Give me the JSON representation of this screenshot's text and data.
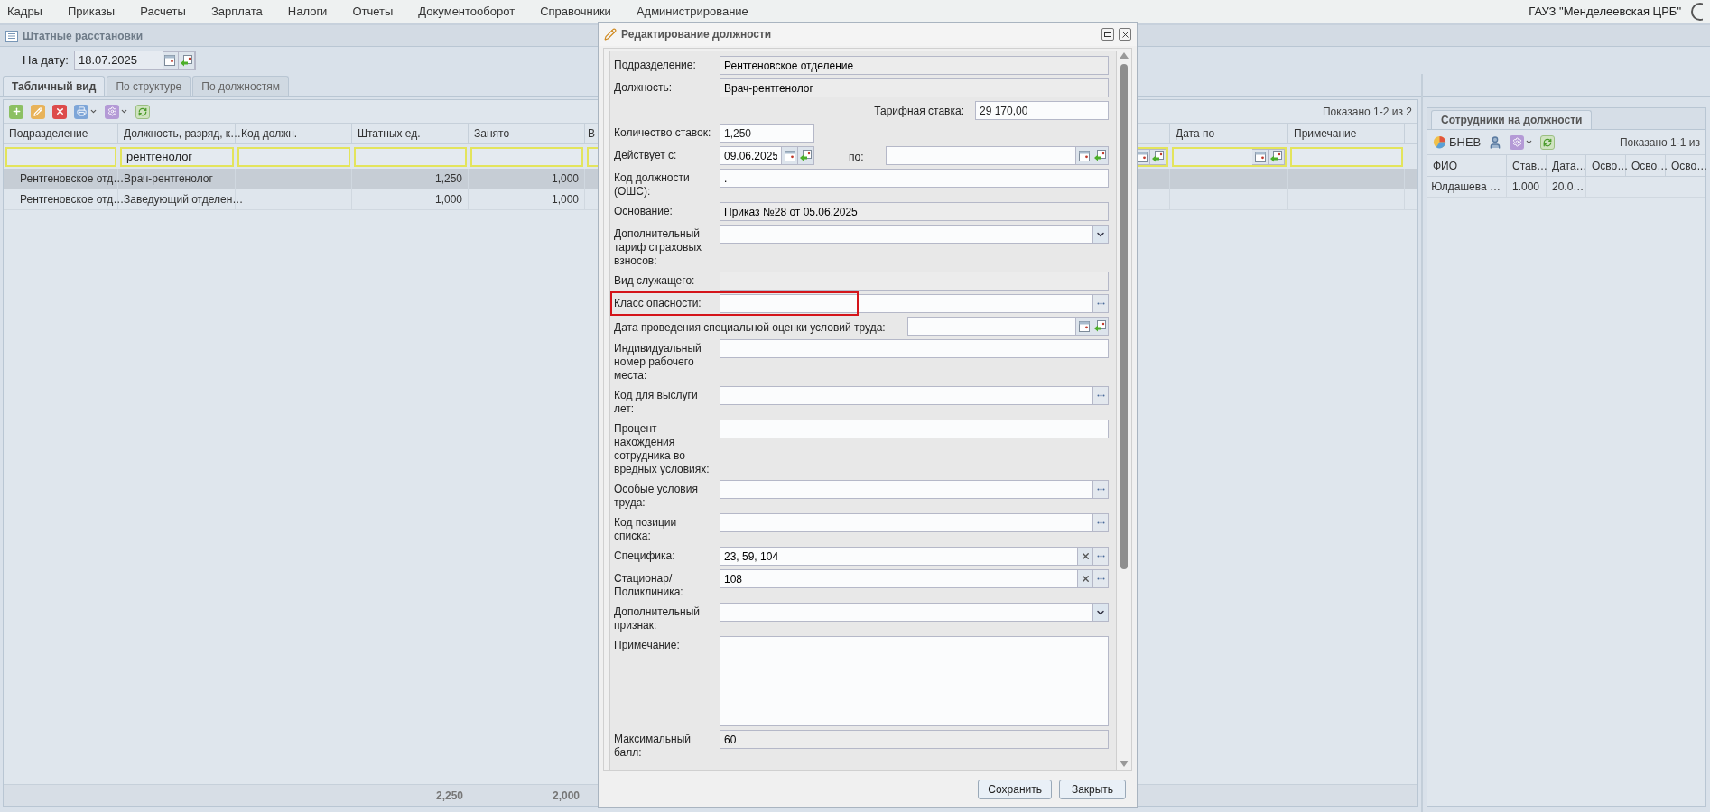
{
  "menu": [
    "Кадры",
    "Приказы",
    "Расчеты",
    "Зарплата",
    "Налоги",
    "Отчеты",
    "Документооборот",
    "Справочники",
    "Администрирование"
  ],
  "organization": "ГАУЗ \"Менделеевская ЦРБ\"",
  "panel": {
    "title": "Штатные расстановки",
    "date_label": "На дату:",
    "date_value": "18.07.2025"
  },
  "tabs": [
    {
      "label": "Табличный вид",
      "selected": true
    },
    {
      "label": "По структуре",
      "selected": false
    },
    {
      "label": "По должностям",
      "selected": false
    }
  ],
  "grid": {
    "paging": "Показано 1-2 из 2",
    "columns": [
      {
        "header": "Подразделение",
        "kind": "text"
      },
      {
        "header": "Должность, разряд, к…",
        "kind": "text",
        "filter_value": "рентгенолог"
      },
      {
        "header": "Код должн.",
        "kind": "text"
      },
      {
        "header": "Штатных ед.",
        "kind": "text"
      },
      {
        "header": "Занято",
        "kind": "text"
      },
      {
        "header": "В",
        "kind": "text"
      },
      {
        "kind": "date"
      },
      {
        "header": "Дата по",
        "kind": "date"
      },
      {
        "header": "Примечание",
        "kind": "text"
      }
    ],
    "rows": [
      {
        "selected": true,
        "subdivision": "Рентгеновское отд…",
        "position": "Врач-рентгенолог",
        "staff_units": "1,250",
        "occupied": "1,000"
      },
      {
        "selected": false,
        "subdivision": "Рентгеновское отд…",
        "position": "Заведующий отделен…",
        "staff_units": "1,000",
        "occupied": "1,000"
      }
    ],
    "totals": {
      "staff_units": "2,250",
      "occupied": "2,000"
    }
  },
  "employees": {
    "tab": "Сотрудники на должности",
    "button": "БНЕВ",
    "paging": "Показано 1-1 из",
    "columns": [
      "ФИО",
      "Став…",
      "Дата…",
      "Осво…",
      "Осво…",
      "Осво…"
    ],
    "rows": [
      {
        "cells": [
          "Юлдашева …",
          "1.000",
          "20.0…"
        ]
      }
    ]
  },
  "dialog": {
    "title": "Редактирование должности",
    "fields": [
      {
        "kind": "readonly",
        "label": "Подразделение:",
        "value": "Рентгеновское отделение",
        "highlighted": false
      },
      {
        "kind": "readonly",
        "label": "Должность:",
        "value": "Врач-рентгенолог",
        "highlighted": false
      },
      {
        "kind": "rate",
        "label": "Тарифная ставка:",
        "value": "29 170,00",
        "highlighted": false
      },
      {
        "kind": "short",
        "label": "Количество ставок:",
        "value": "1,250",
        "highlighted": false
      },
      {
        "kind": "period",
        "label": "Действует с:",
        "value": "09.06.2025",
        "to_label": "по:",
        "highlighted": false
      },
      {
        "kind": "text",
        "label": "Код должности (ОШС):",
        "value": ".",
        "highlighted": false
      },
      {
        "kind": "readonly",
        "label": "Основание:",
        "value": "Приказ №28 от 05.06.2025",
        "highlighted": false
      },
      {
        "kind": "combo",
        "label": "Дополнительный тариф страховых взносов:",
        "highlighted": false
      },
      {
        "kind": "readonly",
        "label": "Вид служащего:",
        "highlighted": false
      },
      {
        "kind": "lookup",
        "label": "Класс опасности:",
        "highlighted": true
      },
      {
        "kind": "wide_date",
        "label": "Дата проведения специальной оценки условий труда:",
        "highlighted": false
      },
      {
        "kind": "text",
        "label": "Индивидуальный номер рабочего места:",
        "highlighted": false
      },
      {
        "kind": "lookup",
        "label": "Код для выслуги лет:",
        "highlighted": false
      },
      {
        "kind": "text",
        "label": "Процент нахождения сотрудника во вредных условиях:",
        "highlighted": false
      },
      {
        "kind": "lookup",
        "label": "Особые условия труда:",
        "highlighted": false
      },
      {
        "kind": "lookup",
        "label": "Код позиции списка:",
        "highlighted": false
      },
      {
        "kind": "lookup_clear",
        "label": "Специфика:",
        "value": "23, 59, 104",
        "highlighted": false
      },
      {
        "kind": "lookup_clear",
        "label": "Стационар/ Поликлиника:",
        "value": "108",
        "highlighted": false
      },
      {
        "kind": "combo",
        "label": "Дополнительный признак:",
        "highlighted": false
      },
      {
        "kind": "textarea",
        "label": "Примечание:",
        "highlighted": false
      },
      {
        "kind": "readonly",
        "label": "Максимальный балл:",
        "value": "60",
        "highlighted": false
      }
    ],
    "buttons": [
      "Сохранить",
      "Закрыть"
    ]
  }
}
